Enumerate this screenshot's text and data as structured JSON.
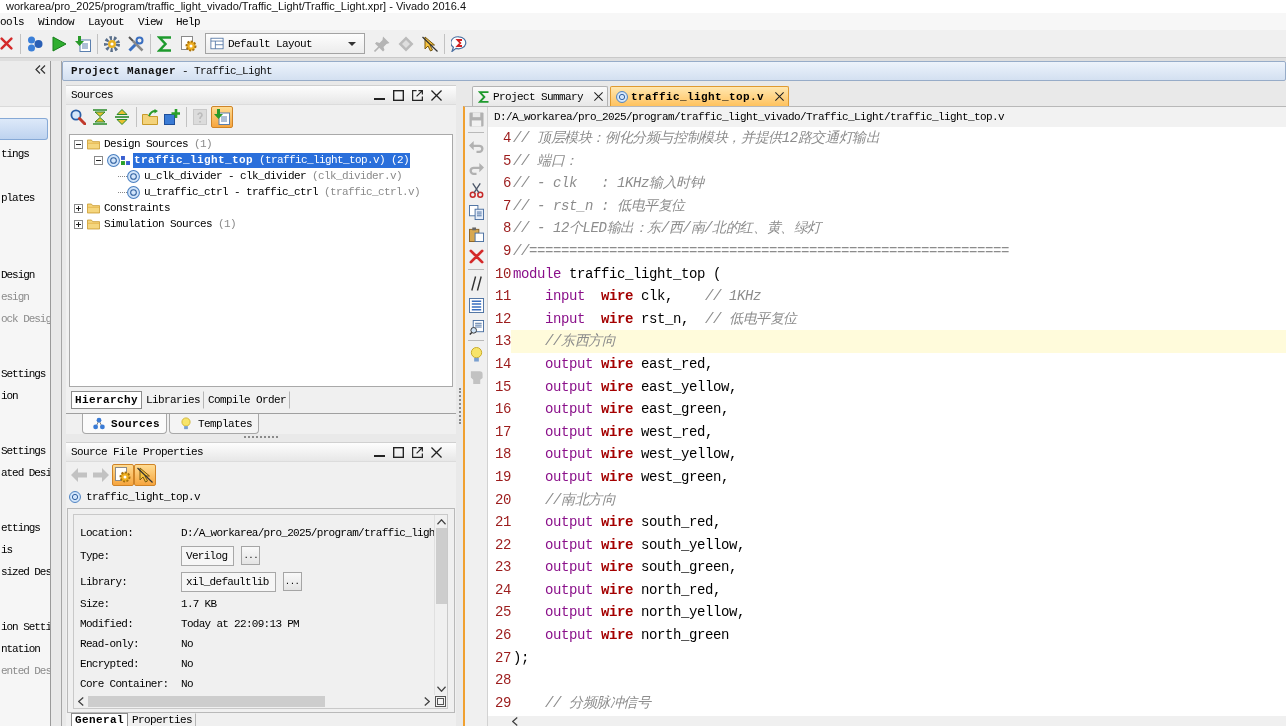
{
  "window": {
    "title": "workarea/pro_2025/program/traffic_light_vivado/Traffic_Light/Traffic_Light.xpr] - Vivado 2016.4"
  },
  "menu": [
    "ools",
    "Window",
    "Layout",
    "View",
    "Help"
  ],
  "toolbar": {
    "buttons": [
      {
        "disabled": false
      },
      {
        "disabled": false
      },
      {
        "disabled": false
      },
      {
        "disabled": false
      },
      {
        "disabled": false
      },
      {
        "disabled": false
      },
      {
        "disabled": false
      },
      {
        "disabled": false
      },
      {
        "disabled": true
      },
      {
        "disabled": true
      },
      {
        "disabled": false
      },
      {
        "disabled": false
      }
    ],
    "layout_menu": "Default Layout"
  },
  "flow_navigator": {
    "items": [
      {
        "selected": true,
        "disabled": false
      },
      {
        "text": "tings",
        "selected": false,
        "disabled": false
      },
      {
        "text": "plates",
        "selected": false,
        "disabled": false
      },
      {
        "text": "Design",
        "selected": false,
        "disabled": false
      },
      {
        "text": "esign",
        "selected": false,
        "disabled": true
      },
      {
        "text": "ock Desig",
        "selected": false,
        "disabled": true
      },
      {
        "text": "Settings",
        "selected": false,
        "disabled": false
      },
      {
        "text": "ion",
        "selected": false,
        "disabled": false
      },
      {
        "text": "Settings",
        "selected": false,
        "disabled": false
      },
      {
        "text": "ated Desi",
        "selected": false,
        "disabled": false
      },
      {
        "text": "ettings",
        "selected": false,
        "disabled": false
      },
      {
        "text": "is",
        "selected": false,
        "disabled": false
      },
      {
        "text": "sized Des",
        "selected": false,
        "disabled": false
      },
      {
        "text": "ion Setti",
        "selected": false,
        "disabled": false
      },
      {
        "text": "ntation",
        "selected": false,
        "disabled": false
      },
      {
        "text": "ented Des",
        "selected": false,
        "disabled": true
      }
    ]
  },
  "header": {
    "title": "**Project Manager** - Traffic_Light"
  },
  "sources_panel": {
    "title": "Sources",
    "tools": [
      {
        "disabled": false,
        "on": false
      },
      {
        "disabled": false,
        "on": false
      },
      {
        "disabled": false,
        "on": false
      },
      {
        "disabled": false,
        "on": false
      },
      {
        "disabled": false,
        "on": false
      },
      {
        "disabled": true,
        "on": false
      },
      {
        "disabled": false,
        "on": true
      }
    ],
    "tree": [
      {
        "kind": "folder",
        "label": "Design Sources",
        "count": "(1)",
        "expanded": true,
        "selected": false,
        "children": [
          {
            "kind": "top_module",
            "label": "traffic_light_top",
            "file": "(traffic_light_top.v)",
            "count": "(2)",
            "expanded": true,
            "selected": true,
            "children": [
              {
                "kind": "module",
                "label": "u_clk_divider - clk_divider",
                "file": "(clk_divider.v)",
                "selected": false
              },
              {
                "kind": "module",
                "label": "u_traffic_ctrl - traffic_ctrl",
                "file": "(traffic_ctrl.v)",
                "selected": false
              }
            ]
          }
        ]
      },
      {
        "kind": "folder",
        "label": "Constraints",
        "expanded": false,
        "selected": false
      },
      {
        "kind": "folder",
        "label": "Simulation Sources",
        "count": "(1)",
        "expanded": false,
        "selected": false
      }
    ],
    "view_tabs": [
      {
        "label": "Hierarchy",
        "selected": true
      },
      {
        "label": "Libraries",
        "selected": false
      },
      {
        "label": "Compile Order",
        "selected": false
      }
    ],
    "panel_tabs": [
      {
        "label": "Sources",
        "selected": true
      },
      {
        "label": "Templates",
        "selected": false
      }
    ]
  },
  "properties_panel": {
    "title": "Source File Properties",
    "tools": [
      {
        "disabled": true,
        "on": false
      },
      {
        "disabled": true,
        "on": false
      },
      {
        "disabled": false,
        "on": true
      },
      {
        "disabled": false,
        "on": true
      }
    ],
    "file": "traffic_light_top.v",
    "rows": [
      {
        "kind": "text",
        "label": "Location:",
        "value": "D:/A_workarea/pro_2025/program/traffic_ligh"
      },
      {
        "kind": "field",
        "label": "Type:",
        "value": "Verilog",
        "button": "..."
      },
      {
        "kind": "field",
        "label": "Library:",
        "value": "xil_defaultlib",
        "button": "..."
      },
      {
        "kind": "text",
        "label": "Size:",
        "value": "1.7 KB"
      },
      {
        "kind": "text",
        "label": "Modified:",
        "value": "Today at 22:09:13 PM"
      },
      {
        "kind": "text",
        "label": "Read-only:",
        "value": "No"
      },
      {
        "kind": "text",
        "label": "Encrypted:",
        "value": "No"
      },
      {
        "kind": "text",
        "label": "Core Container:",
        "value": "No"
      }
    ],
    "tabs": [
      {
        "label": "General",
        "selected": true
      },
      {
        "label": "Properties",
        "selected": false
      }
    ]
  },
  "editor": {
    "tabs": [
      {
        "kind": "summary",
        "label": "Project Summary",
        "selected": false
      },
      {
        "kind": "source",
        "label": "traffic_light_top.v",
        "selected": true
      }
    ],
    "path": "D:/A_workarea/pro_2025/program/traffic_light_vivado/Traffic_Light/traffic_light_top.v",
    "tools": [
      {
        "disabled": true
      },
      {
        "disabled": true
      },
      {
        "disabled": true
      },
      {
        "disabled": false
      },
      {
        "disabled": false
      },
      {
        "disabled": false
      },
      {
        "disabled": false
      },
      {
        "disabled": false
      },
      {
        "disabled": false
      },
      {
        "disabled": false
      },
      {
        "disabled": false
      },
      {
        "disabled": true
      }
    ],
    "lines": [
      {
        "number": "4",
        "current": false,
        "indented": false,
        "tokens": [
          {
            "kind": "comment",
            "text": "// 顶层模块：例化分频与控制模块，并提供12路交通灯输出"
          }
        ]
      },
      {
        "number": "5",
        "current": false,
        "indented": false,
        "tokens": [
          {
            "kind": "comment",
            "text": "// 端口："
          }
        ]
      },
      {
        "number": "6",
        "current": false,
        "indented": false,
        "tokens": [
          {
            "kind": "comment",
            "text": "// - clk   : 1KHz输入时钟"
          }
        ]
      },
      {
        "number": "7",
        "current": false,
        "indented": false,
        "tokens": [
          {
            "kind": "comment",
            "text": "// - rst_n : 低电平复位"
          }
        ]
      },
      {
        "number": "8",
        "current": false,
        "indented": false,
        "tokens": [
          {
            "kind": "comment",
            "text": "// - 12个LED输出：东/西/南/北的红、黄、绿灯"
          }
        ]
      },
      {
        "number": "9",
        "current": false,
        "indented": false,
        "tokens": [
          {
            "kind": "comment",
            "text": "//============================================================"
          }
        ]
      },
      {
        "number": "10",
        "current": false,
        "indented": false,
        "tokens": [
          {
            "kind": "keyword",
            "text": "module"
          },
          {
            "kind": "plain",
            "text": " traffic_light_top ("
          }
        ]
      },
      {
        "number": "11",
        "current": false,
        "indented": true,
        "tokens": [
          {
            "kind": "keyword",
            "text": "input  "
          },
          {
            "kind": "type",
            "text": "wire"
          },
          {
            "kind": "plain",
            "text": " clk,    "
          },
          {
            "kind": "comment",
            "text": "// 1KHz"
          }
        ]
      },
      {
        "number": "12",
        "current": false,
        "indented": true,
        "tokens": [
          {
            "kind": "keyword",
            "text": "input  "
          },
          {
            "kind": "type",
            "text": "wire"
          },
          {
            "kind": "plain",
            "text": " rst_n,  "
          },
          {
            "kind": "comment",
            "text": "// 低电平复位"
          }
        ]
      },
      {
        "number": "13",
        "current": true,
        "indented": true,
        "tokens": [
          {
            "kind": "comment",
            "text": "//东西方向"
          }
        ]
      },
      {
        "number": "14",
        "current": false,
        "indented": true,
        "tokens": [
          {
            "kind": "keyword",
            "text": "output "
          },
          {
            "kind": "type",
            "text": "wire"
          },
          {
            "kind": "plain",
            "text": " east_red,"
          }
        ]
      },
      {
        "number": "15",
        "current": false,
        "indented": true,
        "tokens": [
          {
            "kind": "keyword",
            "text": "output "
          },
          {
            "kind": "type",
            "text": "wire"
          },
          {
            "kind": "plain",
            "text": " east_yellow,"
          }
        ]
      },
      {
        "number": "16",
        "current": false,
        "indented": true,
        "tokens": [
          {
            "kind": "keyword",
            "text": "output "
          },
          {
            "kind": "type",
            "text": "wire"
          },
          {
            "kind": "plain",
            "text": " east_green,"
          }
        ]
      },
      {
        "number": "17",
        "current": false,
        "indented": true,
        "tokens": [
          {
            "kind": "keyword",
            "text": "output "
          },
          {
            "kind": "type",
            "text": "wire"
          },
          {
            "kind": "plain",
            "text": " west_red,"
          }
        ]
      },
      {
        "number": "18",
        "current": false,
        "indented": true,
        "tokens": [
          {
            "kind": "keyword",
            "text": "output "
          },
          {
            "kind": "type",
            "text": "wire"
          },
          {
            "kind": "plain",
            "text": " west_yellow,"
          }
        ]
      },
      {
        "number": "19",
        "current": false,
        "indented": true,
        "tokens": [
          {
            "kind": "keyword",
            "text": "output "
          },
          {
            "kind": "type",
            "text": "wire"
          },
          {
            "kind": "plain",
            "text": " west_green,"
          }
        ]
      },
      {
        "number": "20",
        "current": false,
        "indented": true,
        "tokens": [
          {
            "kind": "comment",
            "text": "//南北方向"
          }
        ]
      },
      {
        "number": "21",
        "current": false,
        "indented": true,
        "tokens": [
          {
            "kind": "keyword",
            "text": "output "
          },
          {
            "kind": "type",
            "text": "wire"
          },
          {
            "kind": "plain",
            "text": " south_red,"
          }
        ]
      },
      {
        "number": "22",
        "current": false,
        "indented": true,
        "tokens": [
          {
            "kind": "keyword",
            "text": "output "
          },
          {
            "kind": "type",
            "text": "wire"
          },
          {
            "kind": "plain",
            "text": " south_yellow,"
          }
        ]
      },
      {
        "number": "23",
        "current": false,
        "indented": true,
        "tokens": [
          {
            "kind": "keyword",
            "text": "output "
          },
          {
            "kind": "type",
            "text": "wire"
          },
          {
            "kind": "plain",
            "text": " south_green,"
          }
        ]
      },
      {
        "number": "24",
        "current": false,
        "indented": true,
        "tokens": [
          {
            "kind": "keyword",
            "text": "output "
          },
          {
            "kind": "type",
            "text": "wire"
          },
          {
            "kind": "plain",
            "text": " north_red,"
          }
        ]
      },
      {
        "number": "25",
        "current": false,
        "indented": true,
        "tokens": [
          {
            "kind": "keyword",
            "text": "output "
          },
          {
            "kind": "type",
            "text": "wire"
          },
          {
            "kind": "plain",
            "text": " north_yellow,"
          }
        ]
      },
      {
        "number": "26",
        "current": false,
        "indented": true,
        "tokens": [
          {
            "kind": "keyword",
            "text": "output "
          },
          {
            "kind": "type",
            "text": "wire"
          },
          {
            "kind": "plain",
            "text": " north_green"
          }
        ]
      },
      {
        "number": "27",
        "current": false,
        "indented": false,
        "tokens": [
          {
            "kind": "plain",
            "text": ");"
          }
        ]
      },
      {
        "number": "28",
        "current": false
      },
      {
        "number": "29",
        "current": false,
        "indented": true,
        "tokens": [
          {
            "kind": "comment",
            "text": "// 分频脉冲信号"
          }
        ]
      }
    ]
  }
}
